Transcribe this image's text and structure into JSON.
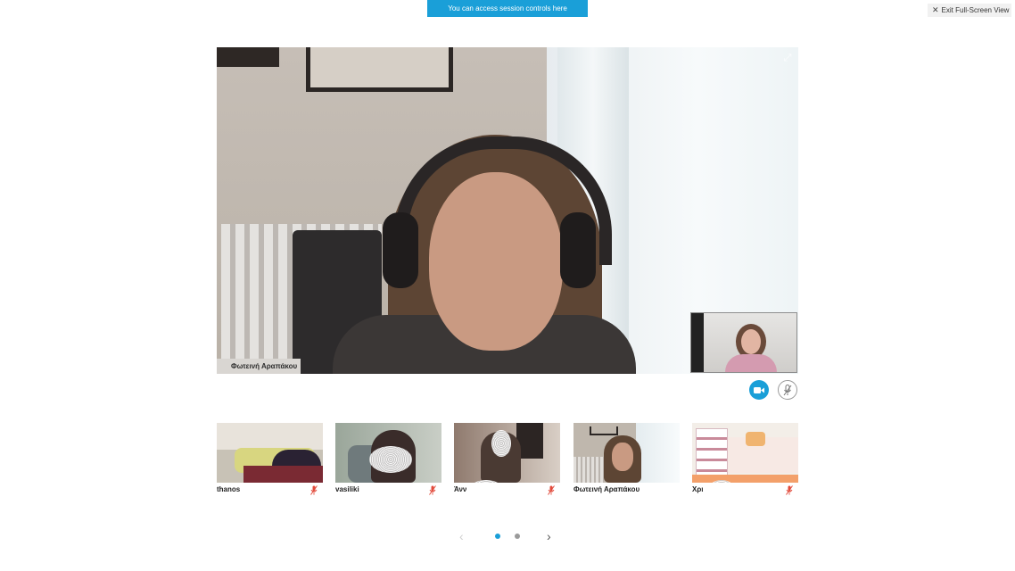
{
  "banner": {
    "tip_text": "You can access session controls here",
    "color": "#1a9fd8"
  },
  "window_controls": {
    "exit_label": "Exit Full-Screen View",
    "exit_icon": "close-icon"
  },
  "main_video": {
    "participant_name": "Φωτεινή Αραπάκου",
    "expand_icon": "expand-icon"
  },
  "self_view": {
    "icon": "self-camera-preview"
  },
  "controls": {
    "camera_icon": "video-camera-icon",
    "mic_icon": "microphone-muted-icon",
    "active_color": "#1a9fd8"
  },
  "participants": [
    {
      "name": "thanos",
      "mic": "muted"
    },
    {
      "name": "vasiliki",
      "mic": "muted"
    },
    {
      "name": "Άνν",
      "mic": "muted"
    },
    {
      "name": "Φωτεινή Αραπάκου",
      "mic": "on"
    },
    {
      "name": "Χρι",
      "mic": "muted"
    }
  ],
  "pagination": {
    "pages": 2,
    "current_page": 1,
    "prev_icon": "chevron-left-icon",
    "next_icon": "chevron-right-icon"
  }
}
